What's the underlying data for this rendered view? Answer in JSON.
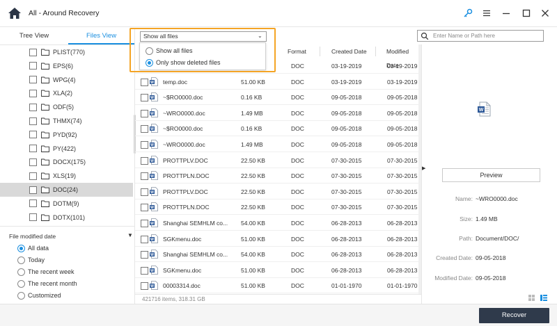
{
  "window": {
    "title": "All - Around Recovery",
    "icons": [
      "home-icon",
      "key-icon",
      "menu-icon",
      "minimize-icon",
      "maximize-icon",
      "close-icon"
    ]
  },
  "tabs": [
    {
      "label": "Tree View",
      "active": false
    },
    {
      "label": "Files View",
      "active": true
    }
  ],
  "tree": {
    "items": [
      {
        "label": "PLIST(770)",
        "selected": false
      },
      {
        "label": "EPS(6)",
        "selected": false
      },
      {
        "label": "WPG(4)",
        "selected": false
      },
      {
        "label": "XLA(2)",
        "selected": false
      },
      {
        "label": "ODF(5)",
        "selected": false
      },
      {
        "label": "THMX(74)",
        "selected": false
      },
      {
        "label": "PYD(92)",
        "selected": false
      },
      {
        "label": "PY(422)",
        "selected": false
      },
      {
        "label": "DOCX(175)",
        "selected": false
      },
      {
        "label": "XLS(19)",
        "selected": false
      },
      {
        "label": "DOC(24)",
        "selected": true
      },
      {
        "label": "DOTM(9)",
        "selected": false
      },
      {
        "label": "DOTX(101)",
        "selected": false
      }
    ]
  },
  "filter": {
    "title": "File modified date",
    "options": [
      {
        "label": "All data",
        "selected": true
      },
      {
        "label": "Today",
        "selected": false
      },
      {
        "label": "The recent week",
        "selected": false
      },
      {
        "label": "The recent month",
        "selected": false
      },
      {
        "label": "Customized",
        "selected": false
      }
    ]
  },
  "show_filter": {
    "value": "Show all files",
    "options": [
      {
        "label": "Show all files",
        "selected": false
      },
      {
        "label": "Only show deleted files",
        "selected": true
      }
    ]
  },
  "search": {
    "placeholder": "Enter Name or Path here"
  },
  "table": {
    "headers": {
      "format": "Format",
      "created": "Created Date",
      "modified": "Modified Date"
    },
    "rows": [
      {
        "name": "",
        "size": "",
        "format": "DOC",
        "created": "03-19-2019",
        "modified": "03-19-2019"
      },
      {
        "name": "temp.doc",
        "size": "51.00  KB",
        "format": "DOC",
        "created": "03-19-2019",
        "modified": "03-19-2019"
      },
      {
        "name": "~$RO0000.doc",
        "size": "0.16  KB",
        "format": "DOC",
        "created": "09-05-2018",
        "modified": "09-05-2018"
      },
      {
        "name": "~WRO0000.doc",
        "size": "1.49  MB",
        "format": "DOC",
        "created": "09-05-2018",
        "modified": "09-05-2018"
      },
      {
        "name": "~$RO0000.doc",
        "size": "0.16  KB",
        "format": "DOC",
        "created": "09-05-2018",
        "modified": "09-05-2018"
      },
      {
        "name": "~WRO0000.doc",
        "size": "1.49  MB",
        "format": "DOC",
        "created": "09-05-2018",
        "modified": "09-05-2018"
      },
      {
        "name": "PROTTPLV.DOC",
        "size": "22.50  KB",
        "format": "DOC",
        "created": "07-30-2015",
        "modified": "07-30-2015"
      },
      {
        "name": "PROTTPLN.DOC",
        "size": "22.50  KB",
        "format": "DOC",
        "created": "07-30-2015",
        "modified": "07-30-2015"
      },
      {
        "name": "PROTTPLV.DOC",
        "size": "22.50  KB",
        "format": "DOC",
        "created": "07-30-2015",
        "modified": "07-30-2015"
      },
      {
        "name": "PROTTPLN.DOC",
        "size": "22.50  KB",
        "format": "DOC",
        "created": "07-30-2015",
        "modified": "07-30-2015"
      },
      {
        "name": "Shanghai SEMHLM co...",
        "size": "54.00  KB",
        "format": "DOC",
        "created": "06-28-2013",
        "modified": "06-28-2013"
      },
      {
        "name": "SGKmenu.doc",
        "size": "51.00  KB",
        "format": "DOC",
        "created": "06-28-2013",
        "modified": "06-28-2013"
      },
      {
        "name": "Shanghai SEMHLM co...",
        "size": "54.00  KB",
        "format": "DOC",
        "created": "06-28-2013",
        "modified": "06-28-2013"
      },
      {
        "name": "SGKmenu.doc",
        "size": "51.00  KB",
        "format": "DOC",
        "created": "06-28-2013",
        "modified": "06-28-2013"
      },
      {
        "name": "00003314.doc",
        "size": "51.00  KB",
        "format": "DOC",
        "created": "01-01-1970",
        "modified": "01-01-1970"
      }
    ]
  },
  "status": "421716 items, 318.31   GB",
  "preview": {
    "button": "Preview",
    "name_label": "Name:",
    "name": "~WRO0000.doc",
    "size_label": "Size:",
    "size": "1.49  MB",
    "path_label": "Path:",
    "path": "Document/DOC/",
    "created_label": "Created Date:",
    "created": "09-05-2018",
    "modified_label": "Modified Date:",
    "modified": "09-05-2018"
  },
  "footer": {
    "recover": "Recover"
  },
  "colors": {
    "accent": "#1a8fe0",
    "highlight": "#f4a425",
    "recover_bg": "#2f3a4b",
    "selected_row": "#d9d9d9"
  }
}
